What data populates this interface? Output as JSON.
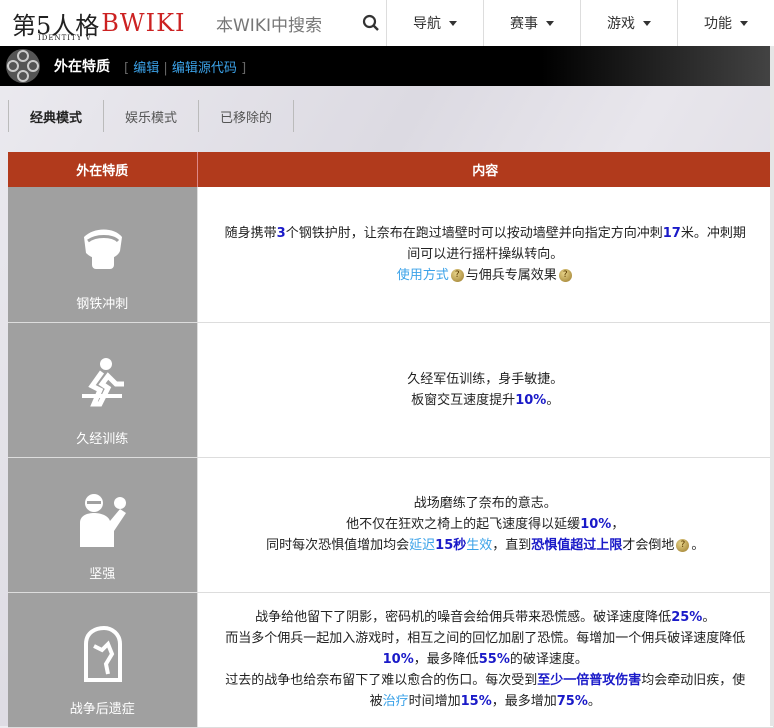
{
  "header": {
    "logo_text": "第5人格",
    "logo_sub": "IDENTITY V",
    "logo_bwiki": "BWIKI",
    "search_placeholder": "本WIKI中搜索",
    "nav": [
      {
        "label": "导航"
      },
      {
        "label": "赛事"
      },
      {
        "label": "游戏"
      },
      {
        "label": "功能"
      }
    ]
  },
  "page": {
    "title": "外在特质",
    "edit": "编辑",
    "edit_source": "编辑源代码",
    "bracket_open": "[",
    "bracket_close": "]",
    "sep": "|"
  },
  "tabs": [
    {
      "label": "经典模式",
      "active": true
    },
    {
      "label": "娱乐模式"
    },
    {
      "label": "已移除的"
    }
  ],
  "table": {
    "headers": [
      "外在特质",
      "内容"
    ],
    "rows": [
      {
        "name": "钢铁冲刺",
        "icon": "steel-elbow-icon",
        "lines": [
          [
            {
              "t": "随身携带",
              "s": ""
            },
            {
              "t": "3",
              "s": "num"
            },
            {
              "t": "个钢铁护肘，让奈布在跑过墙壁时可以按动墙壁并向指定方向冲刺",
              "s": ""
            },
            {
              "t": "17",
              "s": "num"
            },
            {
              "t": "米。冲刺期间可以进行摇杆操纵转向。",
              "s": ""
            }
          ],
          [
            {
              "t": "使用方式",
              "s": "lnk"
            },
            {
              "t": "?",
              "s": "q"
            },
            {
              "t": "与佣兵专属效果",
              "s": ""
            },
            {
              "t": "?",
              "s": "q"
            }
          ]
        ]
      },
      {
        "name": "久经训练",
        "icon": "vault-runner-icon",
        "lines": [
          [
            {
              "t": "久经军伍训练，身手敏捷。",
              "s": ""
            }
          ],
          [
            {
              "t": "板窗交互速度提升",
              "s": ""
            },
            {
              "t": "10%",
              "s": "num"
            },
            {
              "t": "。",
              "s": ""
            }
          ]
        ]
      },
      {
        "name": "坚强",
        "icon": "strong-man-icon",
        "lines": [
          [
            {
              "t": "战场磨练了奈布的意志。",
              "s": ""
            }
          ],
          [
            {
              "t": "他不仅在狂欢之椅上的起飞速度得以延缓",
              "s": ""
            },
            {
              "t": "10%",
              "s": "num"
            },
            {
              "t": "，",
              "s": ""
            }
          ],
          [
            {
              "t": "同时每次恐惧值增加均会",
              "s": ""
            },
            {
              "t": "延迟",
              "s": "lnk"
            },
            {
              "t": "15秒",
              "s": "num"
            },
            {
              "t": "生效",
              "s": "lnk"
            },
            {
              "t": "，直到",
              "s": ""
            },
            {
              "t": "恐惧值超过上限",
              "s": "strong"
            },
            {
              "t": "才会倒地",
              "s": ""
            },
            {
              "t": "?",
              "s": "q"
            },
            {
              "t": "。",
              "s": ""
            }
          ]
        ]
      },
      {
        "name": "战争后遗症",
        "icon": "tombstone-icon",
        "lines": [
          [
            {
              "t": "战争给他留下了阴影，密码机的噪音会给佣兵带来恐慌感。破译速度降低",
              "s": ""
            },
            {
              "t": "25%",
              "s": "num"
            },
            {
              "t": "。",
              "s": ""
            }
          ],
          [
            {
              "t": "而当多个佣兵一起加入游戏时，相互之间的回忆加剧了恐慌。每增加一个佣兵破译速度降低",
              "s": ""
            },
            {
              "t": "10%",
              "s": "num"
            },
            {
              "t": "，最多降低",
              "s": ""
            },
            {
              "t": "55%",
              "s": "num"
            },
            {
              "t": "的破译速度。",
              "s": ""
            }
          ],
          [
            {
              "t": "过去的战争也给奈布留下了难以愈合的伤口。每次受到",
              "s": ""
            },
            {
              "t": "至少一倍普攻伤害",
              "s": "strong"
            },
            {
              "t": "均会牵动旧疾，使被",
              "s": ""
            },
            {
              "t": "治疗",
              "s": "lnk"
            },
            {
              "t": "时间增加",
              "s": ""
            },
            {
              "t": "15%",
              "s": "num"
            },
            {
              "t": "，最多增加",
              "s": ""
            },
            {
              "t": "75%",
              "s": "num"
            },
            {
              "t": "。",
              "s": ""
            }
          ]
        ]
      }
    ]
  }
}
